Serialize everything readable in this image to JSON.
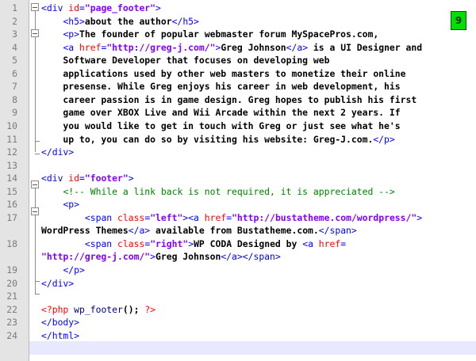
{
  "editor": {
    "badge": "9",
    "gutter": {
      "line_numbers": [
        "1",
        "2",
        "3",
        "4",
        "5",
        "6",
        "7",
        "8",
        "9",
        "10",
        "11",
        "12",
        "13",
        "14",
        "15",
        "16",
        "17",
        "",
        "18",
        "",
        "19",
        "20",
        "21",
        "22",
        "23",
        "24"
      ]
    },
    "code": [
      {
        "parts": [
          [
            "tag",
            "<div "
          ],
          [
            "attr",
            "id"
          ],
          [
            "tag",
            "="
          ],
          [
            "str",
            "\"page_footer\""
          ],
          [
            "tag",
            ">"
          ]
        ]
      },
      {
        "parts": [
          [
            "pl",
            "    "
          ],
          [
            "tag",
            "<h5>"
          ],
          [
            "pl",
            "about the author"
          ],
          [
            "tag",
            "</h5>"
          ]
        ]
      },
      {
        "parts": [
          [
            "pl",
            "    "
          ],
          [
            "tag",
            "<p>"
          ],
          [
            "pl",
            "The founder of popular webmaster forum MySpacePros.com,"
          ]
        ]
      },
      {
        "parts": [
          [
            "pl",
            "    "
          ],
          [
            "tag",
            "<a "
          ],
          [
            "attr",
            "href"
          ],
          [
            "tag",
            "="
          ],
          [
            "str",
            "\"http://greg-j.com/\""
          ],
          [
            "tag",
            ">"
          ],
          [
            "pl",
            "Greg Johnson"
          ],
          [
            "tag",
            "</a>"
          ],
          [
            "pl",
            " is a UI Designer and"
          ]
        ]
      },
      {
        "parts": [
          [
            "pl",
            "    Software Developer that focuses on developing web"
          ]
        ]
      },
      {
        "parts": [
          [
            "pl",
            "    applications used by other web masters to monetize their online"
          ]
        ]
      },
      {
        "parts": [
          [
            "pl",
            "    presense. While Greg enjoys his career in web development, his"
          ]
        ]
      },
      {
        "parts": [
          [
            "pl",
            "    career passion is in game design. Greg hopes to publish his first"
          ]
        ]
      },
      {
        "parts": [
          [
            "pl",
            "    game over XBOX Live and Wii Arcade within the next 2 years. If"
          ]
        ]
      },
      {
        "parts": [
          [
            "pl",
            "    you would like to get in touch with Greg or just see what he's"
          ]
        ]
      },
      {
        "parts": [
          [
            "pl",
            "    up to, you can do so by visiting his website: Greg-J.com."
          ],
          [
            "tag",
            "</p>"
          ]
        ]
      },
      {
        "parts": [
          [
            "tag",
            "</div>"
          ]
        ]
      },
      {
        "parts": []
      },
      {
        "parts": [
          [
            "tag",
            "<div "
          ],
          [
            "attr",
            "id"
          ],
          [
            "tag",
            "="
          ],
          [
            "str",
            "\"footer\""
          ],
          [
            "tag",
            ">"
          ]
        ]
      },
      {
        "parts": [
          [
            "pl",
            "    "
          ],
          [
            "comment",
            "<!-- While a link back is not required, it is appreciated -->"
          ]
        ]
      },
      {
        "parts": [
          [
            "pl",
            "    "
          ],
          [
            "tag",
            "<p>"
          ]
        ]
      },
      {
        "parts": [
          [
            "pl",
            "        "
          ],
          [
            "tag",
            "<span "
          ],
          [
            "attr",
            "class"
          ],
          [
            "tag",
            "="
          ],
          [
            "str",
            "\"left\""
          ],
          [
            "tag",
            "><a "
          ],
          [
            "attr",
            "href"
          ],
          [
            "tag",
            "="
          ],
          [
            "str",
            "\"http://bustatheme.com/wordpress/\""
          ],
          [
            "tag",
            ">"
          ]
        ]
      },
      {
        "parts": [
          [
            "pl",
            "WordPress Themes"
          ],
          [
            "tag",
            "</a>"
          ],
          [
            "pl",
            " available from Bustatheme.com."
          ],
          [
            "tag",
            "</span>"
          ]
        ]
      },
      {
        "parts": [
          [
            "pl",
            "        "
          ],
          [
            "tag",
            "<span "
          ],
          [
            "attr",
            "class"
          ],
          [
            "tag",
            "="
          ],
          [
            "str",
            "\"right\""
          ],
          [
            "tag",
            ">"
          ],
          [
            "pl",
            "WP CODA Designed by "
          ],
          [
            "tag",
            "<a "
          ],
          [
            "attr",
            "href"
          ],
          [
            "tag",
            "="
          ]
        ]
      },
      {
        "parts": [
          [
            "str",
            "\"http://greg-j.com/\""
          ],
          [
            "tag",
            ">"
          ],
          [
            "pl",
            "Greg Johnson"
          ],
          [
            "tag",
            "</a></span>"
          ]
        ]
      },
      {
        "parts": [
          [
            "pl",
            "    "
          ],
          [
            "tag",
            "</p>"
          ]
        ]
      },
      {
        "parts": [
          [
            "tag",
            "</div>"
          ]
        ]
      },
      {
        "parts": []
      },
      {
        "parts": [
          [
            "php",
            "<?php "
          ],
          [
            "kw",
            "wp_footer"
          ],
          [
            "pl",
            "(); "
          ],
          [
            "php",
            "?>"
          ]
        ]
      },
      {
        "parts": [
          [
            "tag",
            "</body>"
          ]
        ]
      },
      {
        "parts": [
          [
            "tag",
            "</html>"
          ]
        ]
      }
    ]
  }
}
